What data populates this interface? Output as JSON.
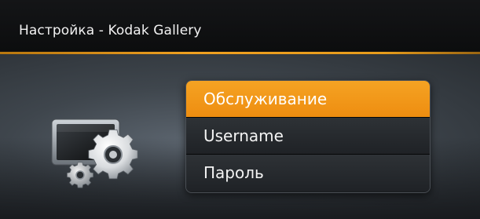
{
  "window": {
    "title": "Настройка - Kodak Gallery"
  },
  "theme": {
    "accent": "#ee8d10",
    "background": "#2a2e33"
  },
  "icon": {
    "name": "settings-icon"
  },
  "menu": {
    "items": [
      {
        "label": "Обслуживание",
        "selected": true
      },
      {
        "label": "Username",
        "selected": false
      },
      {
        "label": "Пароль",
        "selected": false
      }
    ]
  }
}
